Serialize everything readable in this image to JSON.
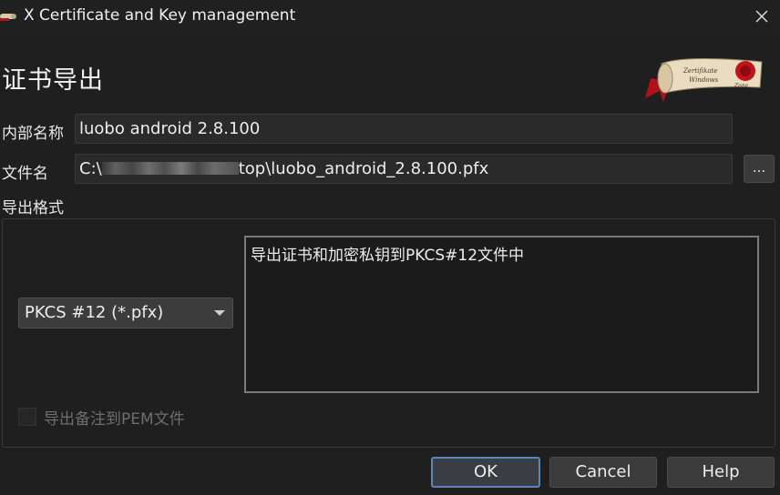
{
  "window": {
    "title": "X Certificate and Key management",
    "app_icon": "scroll-icon",
    "close_icon": "close-icon"
  },
  "page": {
    "heading": "证书导出",
    "logo_icon": "xca-scroll-logo"
  },
  "fields": {
    "name_label": "内部名称",
    "name_value": "luobo android 2.8.100",
    "filename_label": "文件名",
    "filename_prefix": "C:\\",
    "filename_suffix": "top\\luobo_android_2.8.100.pfx",
    "browse_label": "..."
  },
  "export_format": {
    "group_label": "导出格式",
    "selected": "PKCS #12 (*.pfx)",
    "description": "导出证书和加密私钥到PKCS#12文件中",
    "pem_checkbox_label": "导出备注到PEM文件",
    "pem_checkbox_checked": false
  },
  "buttons": {
    "ok": "OK",
    "cancel": "Cancel",
    "help": "Help"
  },
  "colors": {
    "background": "#1f1f1f",
    "default_button_border": "#5b87b8",
    "seal_red": "#c0141c"
  }
}
